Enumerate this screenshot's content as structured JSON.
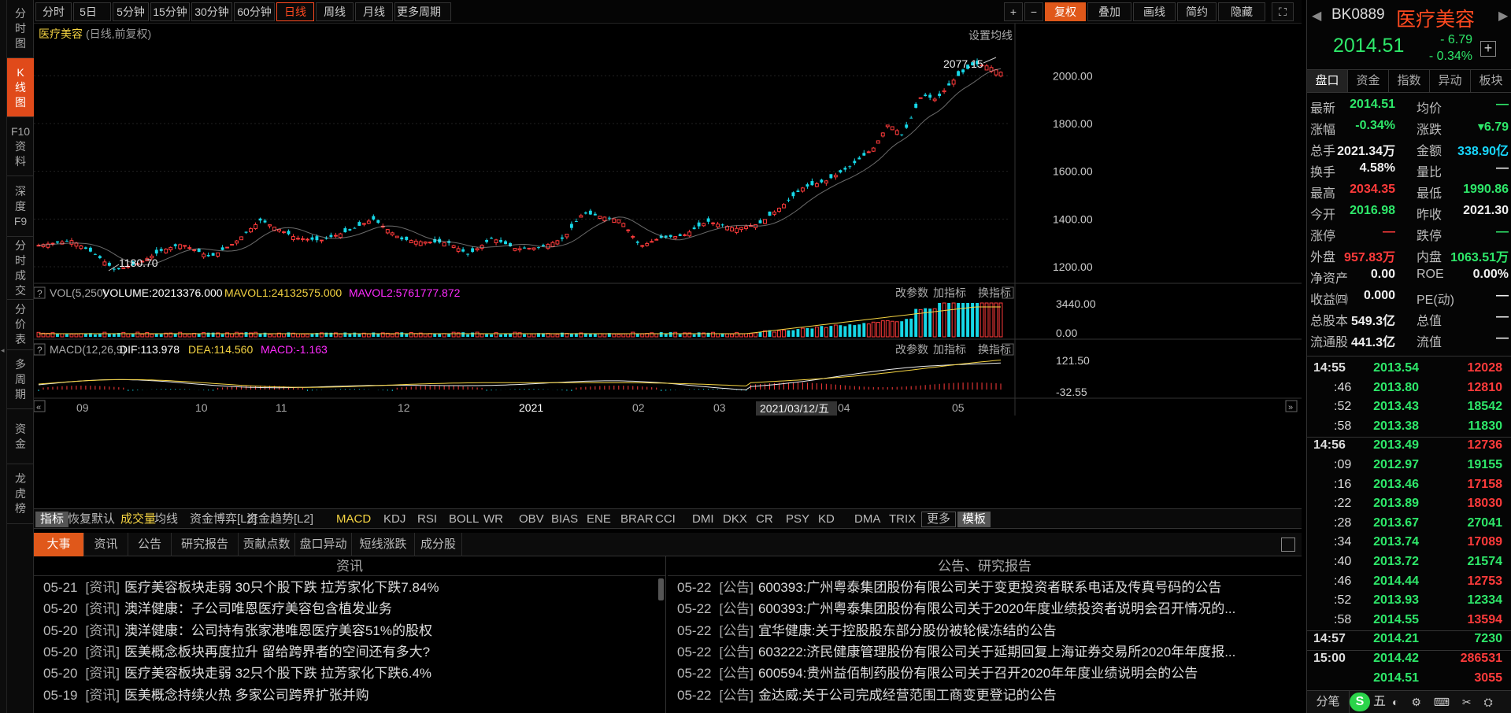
{
  "toolbar": {
    "periods": [
      "分时",
      "5日",
      "5分钟",
      "15分钟",
      "30分钟",
      "60分钟",
      "日线",
      "周线",
      "月线",
      "更多周期"
    ],
    "right_buttons": [
      "+",
      "−",
      "复权",
      "叠加",
      "画线",
      "简约",
      "隐藏"
    ]
  },
  "vtabs": [
    [
      "分",
      "时",
      "图"
    ],
    [
      "K",
      "线",
      "图"
    ],
    [
      "F10",
      "资",
      "料"
    ],
    [
      "深",
      "度",
      "F9"
    ],
    [
      "分",
      "时",
      "成",
      "交"
    ],
    [
      "分",
      "价",
      "表"
    ],
    [
      "多",
      "周",
      "期"
    ],
    [
      "资",
      "金"
    ],
    [
      "龙",
      "虎",
      "榜"
    ]
  ],
  "main": {
    "title": "医疗美容",
    "title_sub": "(日线,前复权)",
    "ma_setting": "设置均线",
    "max_label": "2077.15",
    "min_label": "1180.70",
    "y_ticks": [
      "2000.00",
      "1800.00",
      "1600.00",
      "1400.00",
      "1200.00"
    ]
  },
  "vol": {
    "name": "VOL(5,250)",
    "volume": "VOLUME:20213376.000",
    "mavol1": "MAVOL1:24132575.000",
    "mavol2": "MAVOL2:5761777.872",
    "ticks": [
      "3440.00",
      "0.00"
    ],
    "actions": [
      "改参数",
      "加指标",
      "换指标"
    ]
  },
  "macd": {
    "name": "MACD(12,26,9)",
    "dif": "DIF:113.978",
    "dea": "DEA:114.560",
    "macd": "MACD:-1.163",
    "ticks": [
      "121.50",
      "-32.55"
    ],
    "actions": [
      "改参数",
      "加指标",
      "换指标"
    ]
  },
  "xaxis": {
    "labels": [
      "09",
      "10",
      "11",
      "12",
      "2021",
      "02",
      "03",
      "04",
      "05"
    ],
    "cursor_date": "2021/03/12/五"
  },
  "indicators": [
    "指标",
    "恢复默认",
    "成交量",
    "均线",
    "资金博弈[L2]",
    "资金趋势[L2]",
    "MACD",
    "KDJ",
    "RSI",
    "BOLL",
    "WR",
    "OBV",
    "BIAS",
    "ENE",
    "BRAR",
    "CCI",
    "DMI",
    "DKX",
    "CR",
    "PSY",
    "KD",
    "DMA",
    "TRIX",
    "更多",
    "模板"
  ],
  "news": {
    "tabs": [
      "大事",
      "资讯",
      "公告",
      "研究报告",
      "贡献点数",
      "盘口异动",
      "短线涨跌",
      "成分股"
    ],
    "left_header": "资讯",
    "right_header": "公告、研究报告",
    "left": [
      {
        "date": "05-21",
        "tag": "[资讯]",
        "title": "医疗美容板块走弱 30只个股下跌 拉芳家化下跌7.84%"
      },
      {
        "date": "05-20",
        "tag": "[资讯]",
        "title": "澳洋健康：子公司唯恩医疗美容包含植发业务"
      },
      {
        "date": "05-20",
        "tag": "[资讯]",
        "title": "澳洋健康：公司持有张家港唯恩医疗美容51%的股权"
      },
      {
        "date": "05-20",
        "tag": "[资讯]",
        "title": "医美概念板块再度拉升 留给跨界者的空间还有多大?"
      },
      {
        "date": "05-20",
        "tag": "[资讯]",
        "title": "医疗美容板块走弱 32只个股下跌 拉芳家化下跌6.4%"
      },
      {
        "date": "05-19",
        "tag": "[资讯]",
        "title": "医美概念持续火热 多家公司跨界扩张并购"
      }
    ],
    "right": [
      {
        "date": "05-22",
        "tag": "[公告]",
        "title": "600393:广州粤泰集团股份有限公司关于变更投资者联系电话及传真号码的公告"
      },
      {
        "date": "05-22",
        "tag": "[公告]",
        "title": "600393:广州粤泰集团股份有限公司关于2020年度业绩投资者说明会召开情况的..."
      },
      {
        "date": "05-22",
        "tag": "[公告]",
        "title": "宜华健康:关于控股股东部分股份被轮候冻结的公告"
      },
      {
        "date": "05-22",
        "tag": "[公告]",
        "title": "603222:济民健康管理股份有限公司关于延期回复上海证券交易所2020年年度报..."
      },
      {
        "date": "05-22",
        "tag": "[公告]",
        "title": "600594:贵州益佰制药股份有限公司关于召开2020年年度业绩说明会的公告"
      },
      {
        "date": "05-22",
        "tag": "[公告]",
        "title": "金达威:关于公司完成经营范围工商变更登记的公告"
      }
    ]
  },
  "quote": {
    "code": "BK0889",
    "name": "医疗美容",
    "price": "2014.51",
    "change": "- 6.79",
    "pct": "- 0.34%",
    "tabs": [
      "盘口",
      "资金",
      "指数",
      "异动",
      "板块"
    ],
    "rows": [
      {
        "l1": "最新",
        "v1": "2014.51",
        "c1": "g",
        "l2": "均价",
        "v2": "—",
        "c2": "g"
      },
      {
        "l1": "涨幅",
        "v1": "-0.34%",
        "c1": "g",
        "l2": "涨跌",
        "v2": "▾6.79",
        "c2": "g"
      },
      {
        "l1": "总手",
        "v1": "2021.34万",
        "c1": "w",
        "l2": "金额",
        "v2": "338.90亿",
        "c2": "c"
      },
      {
        "l1": "换手",
        "v1": "4.58%",
        "c1": "w",
        "l2": "量比",
        "v2": "—",
        "c2": "w"
      },
      {
        "l1": "最高",
        "v1": "2034.35",
        "c1": "r",
        "l2": "最低",
        "v2": "1990.86",
        "c2": "g"
      },
      {
        "l1": "今开",
        "v1": "2016.98",
        "c1": "g",
        "l2": "昨收",
        "v2": "2021.30",
        "c2": "w"
      },
      {
        "l1": "涨停",
        "v1": "—",
        "c1": "r",
        "l2": "跌停",
        "v2": "—",
        "c2": "g"
      },
      {
        "l1": "外盘",
        "v1": "957.83万",
        "c1": "r",
        "l2": "内盘",
        "v2": "1063.51万",
        "c2": "g"
      },
      {
        "l1": "净资产",
        "v1": "0.00",
        "c1": "w",
        "l2": "ROE",
        "v2": "0.00%",
        "c2": "w"
      },
      {
        "l1": "收益㈣",
        "v1": "0.000",
        "c1": "w",
        "l2": "PE(动)",
        "v2": "—",
        "c2": "w"
      },
      {
        "l1": "总股本",
        "v1": "549.3亿",
        "c1": "w",
        "l2": "总值",
        "v2": "—",
        "c2": "w"
      },
      {
        "l1": "流通股",
        "v1": "441.3亿",
        "c1": "w",
        "l2": "流值",
        "v2": "—",
        "c2": "w"
      }
    ],
    "ticks": [
      {
        "t": "14:55",
        "p": "2013.54",
        "v": "12028",
        "vc": "r",
        "major": true
      },
      {
        "t": ":46",
        "p": "2013.80",
        "v": "12810",
        "vc": "r"
      },
      {
        "t": ":52",
        "p": "2013.43",
        "v": "18542",
        "vc": "g"
      },
      {
        "t": ":58",
        "p": "2013.38",
        "v": "11830",
        "vc": "g"
      },
      {
        "t": "14:56",
        "p": "2013.49",
        "v": "12736",
        "vc": "r",
        "major": true,
        "sep": true
      },
      {
        "t": ":09",
        "p": "2012.97",
        "v": "19155",
        "vc": "g"
      },
      {
        "t": ":16",
        "p": "2013.46",
        "v": "17158",
        "vc": "r"
      },
      {
        "t": ":22",
        "p": "2013.89",
        "v": "18030",
        "vc": "r"
      },
      {
        "t": ":28",
        "p": "2013.67",
        "v": "27041",
        "vc": "g"
      },
      {
        "t": ":34",
        "p": "2013.74",
        "v": "17089",
        "vc": "r"
      },
      {
        "t": ":40",
        "p": "2013.72",
        "v": "21574",
        "vc": "g"
      },
      {
        "t": ":46",
        "p": "2014.44",
        "v": "12753",
        "vc": "r"
      },
      {
        "t": ":52",
        "p": "2013.93",
        "v": "12334",
        "vc": "g"
      },
      {
        "t": ":58",
        "p": "2014.55",
        "v": "13594",
        "vc": "r"
      },
      {
        "t": "14:57",
        "p": "2014.21",
        "v": "7230",
        "vc": "g",
        "major": true,
        "sep": true
      },
      {
        "t": "15:00",
        "p": "2014.42",
        "v": "286531",
        "vc": "r",
        "major": true,
        "sep": true
      },
      {
        "t": "",
        "p": "2014.51",
        "v": "3055",
        "vc": "r"
      }
    ],
    "bottom_tabs": [
      "分笔",
      "五"
    ]
  },
  "colors": {
    "up": "#ff3b3b",
    "down": "#16d8e8",
    "price_green": "#2ee86a",
    "accent": "#e0581a",
    "yellow": "#f5d442",
    "magenta": "#ff2bff"
  }
}
